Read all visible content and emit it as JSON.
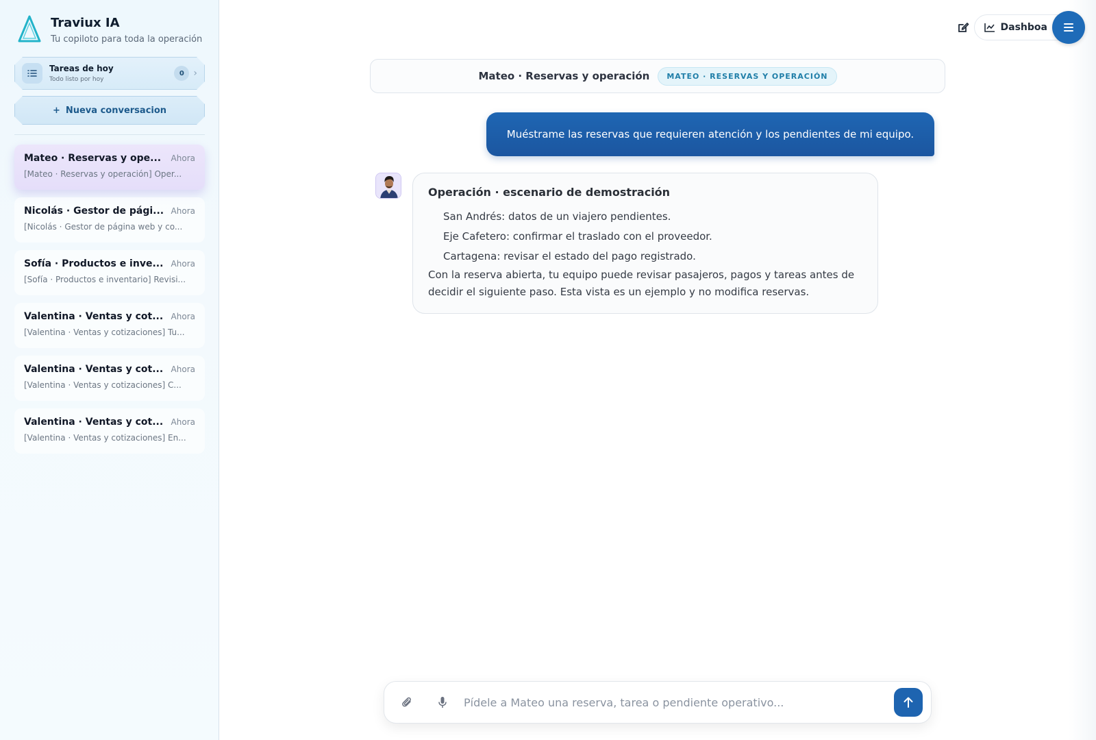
{
  "brand": {
    "title": "Traviux IA",
    "subtitle": "Tu copiloto para toda la operación",
    "logo_icon": "triangle-logo-icon"
  },
  "tasks": {
    "title": "Tareas de hoy",
    "subtitle": "Todo listo por hoy",
    "count": "0"
  },
  "new_conversation": {
    "label": "Nueva conversacion"
  },
  "conversations": [
    {
      "title": "Mateo · Reservas y ope...",
      "time": "Ahora",
      "preview": "[Mateo · Reservas y operación] Oper..."
    },
    {
      "title": "Nicolás · Gestor de pági...",
      "time": "Ahora",
      "preview": "[Nicolás · Gestor de página web y co..."
    },
    {
      "title": "Sofía · Productos e inve...",
      "time": "Ahora",
      "preview": "[Sofía · Productos e inventario] Revisi..."
    },
    {
      "title": "Valentina · Ventas y cot...",
      "time": "Ahora",
      "preview": "[Valentina · Ventas y cotizaciones] Tu..."
    },
    {
      "title": "Valentina · Ventas y cot...",
      "time": "Ahora",
      "preview": "[Valentina · Ventas y cotizaciones] C..."
    },
    {
      "title": "Valentina · Ventas y cot...",
      "time": "Ahora",
      "preview": "[Valentina · Ventas y cotizaciones] En..."
    }
  ],
  "top_actions": {
    "dashboard_label": "Dashboa"
  },
  "chat_header": {
    "title": "Mateo · Reservas y operación",
    "badge": "MATEO · RESERVAS Y OPERACIÓN"
  },
  "messages": {
    "user": "Muéstrame las reservas que requieren atención y los pendientes de mi equipo.",
    "bot_title": "Operación · escenario de demostración",
    "bot_items": [
      "San Andrés: datos de un viajero pendientes.",
      "Eje Cafetero: confirmar el traslado con el proveedor.",
      "Cartagena: revisar el estado del pago registrado."
    ],
    "bot_body": "Con la reserva abierta, tu equipo puede revisar pasajeros, pagos y tareas antes de decidir el siguiente paso. Esta vista es un ejemplo y no modifica reservas."
  },
  "composer": {
    "placeholder": "Pídele a Mateo una reserva, tarea o pendiente operativo..."
  },
  "colors": {
    "accent": "#1e64b0",
    "badge_text": "#1f7ea8",
    "active_conv": "#e7e0fb"
  }
}
